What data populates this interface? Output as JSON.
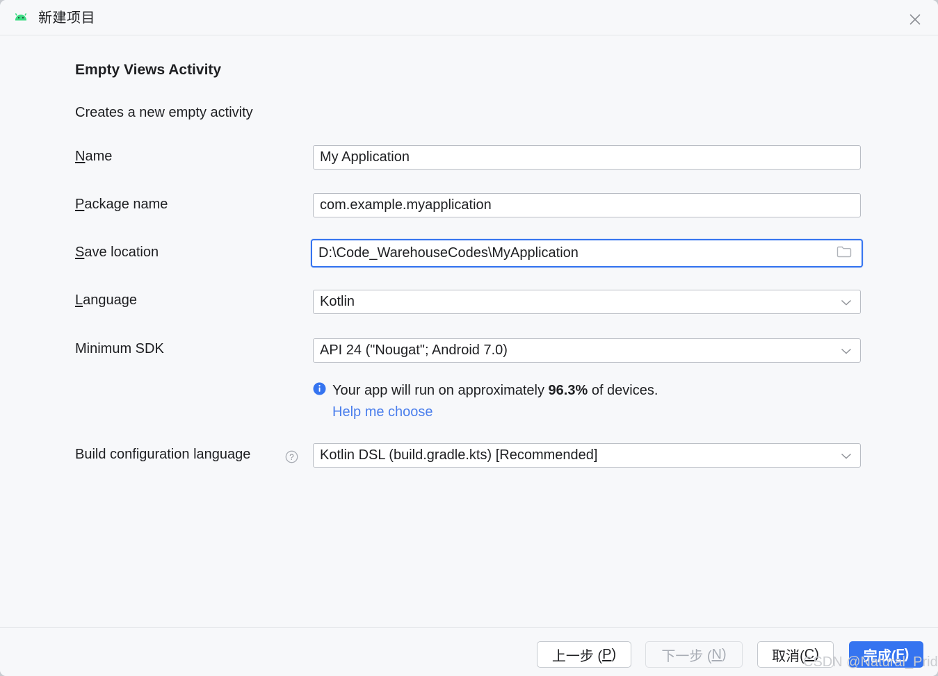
{
  "window": {
    "title": "新建项目",
    "app_icon": "android-robot-icon",
    "close_icon": "close-icon"
  },
  "template": {
    "title": "Empty Views Activity",
    "description": "Creates a new empty activity"
  },
  "form": {
    "name": {
      "label_mnemonic": "N",
      "label_rest": "ame",
      "value": "My Application"
    },
    "package_name": {
      "label_mnemonic": "P",
      "label_rest": "ackage name",
      "value": "com.example.myapplication"
    },
    "save_location": {
      "label_mnemonic": "S",
      "label_rest": "ave location",
      "value": "D:\\Code_WarehouseCodes\\MyApplication",
      "focused": true,
      "browse_icon": "folder-icon"
    },
    "language": {
      "label_mnemonic": "L",
      "label_rest": "anguage",
      "value": "Kotlin"
    },
    "minimum_sdk": {
      "label": "Minimum SDK",
      "value": "API 24 (\"Nougat\"; Android 7.0)"
    },
    "sdk_info": {
      "icon": "info-icon",
      "text_before": "Your app will run on approximately ",
      "percent": "96.3%",
      "text_after": " of devices.",
      "help_link": "Help me choose"
    },
    "build_config": {
      "label": "Build configuration language",
      "help_icon": "question-mark-icon",
      "value": "Kotlin DSL (build.gradle.kts) [Recommended]"
    }
  },
  "footer": {
    "previous": {
      "text": "上一步 (",
      "mnemonic": "P",
      "tail": ")"
    },
    "next": {
      "text": "下一步 (",
      "mnemonic": "N",
      "tail": ")"
    },
    "cancel": {
      "text": "取消(",
      "mnemonic": "C",
      "tail": ")"
    },
    "finish": {
      "text": "完成(",
      "mnemonic": "F",
      "tail": ")"
    }
  },
  "watermark": "CSDN @Natural_Pride",
  "colors": {
    "accent": "#3574f0",
    "link": "#4a7eec",
    "background": "#f7f8fa",
    "field_background": "#ffffff",
    "text": "#1e1f22",
    "disabled_text": "#a8adb5"
  }
}
